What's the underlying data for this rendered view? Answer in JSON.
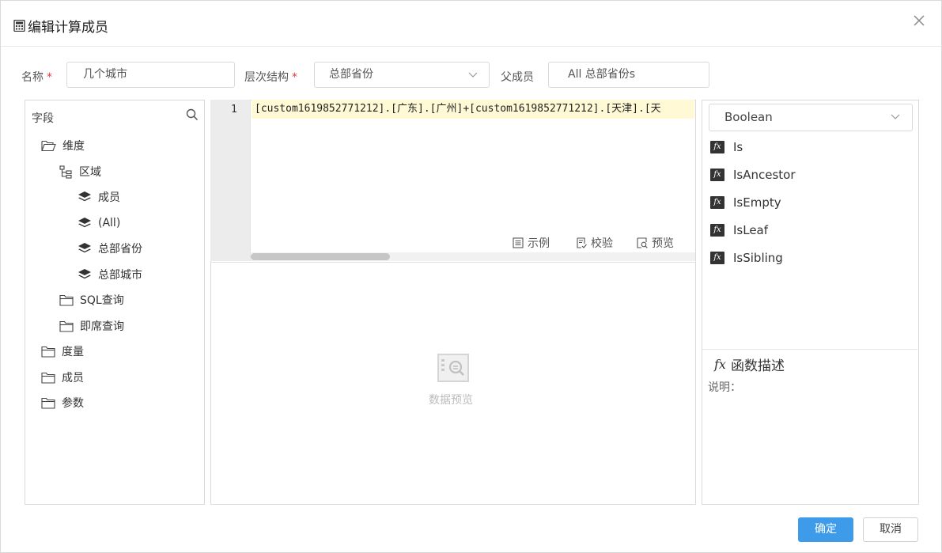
{
  "dialog": {
    "title": "编辑计算成员",
    "close_icon": "close-icon"
  },
  "form": {
    "name_label": "名称",
    "name_required": "*",
    "name_value": "几个城市",
    "hierarchy_label": "层次结构",
    "hierarchy_required": "*",
    "hierarchy_value": "总部省份",
    "parent_label": "父成员",
    "parent_value": "All 总部省份s"
  },
  "fields": {
    "header": "字段",
    "tree": [
      {
        "label": "维度",
        "icon": "folder-open-icon"
      },
      {
        "label": "区域",
        "icon": "hierarchy-icon"
      },
      {
        "label": "成员",
        "icon": "layers-icon"
      },
      {
        "label": "(All)",
        "icon": "layers-icon"
      },
      {
        "label": "总部省份",
        "icon": "layers-icon"
      },
      {
        "label": "总部城市",
        "icon": "layers-icon"
      },
      {
        "label": "SQL查询",
        "icon": "folder-icon"
      },
      {
        "label": "即席查询",
        "icon": "folder-icon"
      },
      {
        "label": "度量",
        "icon": "folder-icon"
      },
      {
        "label": "成员",
        "icon": "folder-icon"
      },
      {
        "label": "参数",
        "icon": "folder-icon"
      }
    ]
  },
  "editor": {
    "line_number": "1",
    "code": "[custom1619852771212].[广东].[广州]+[custom1619852771212].[天津].[天",
    "tools": {
      "example": "示例",
      "validate": "校验",
      "preview": "预览"
    }
  },
  "preview": {
    "empty_text": "数据预览"
  },
  "functions": {
    "category": "Boolean",
    "items": [
      "Is",
      "IsAncestor",
      "IsEmpty",
      "IsLeaf",
      "IsSibling"
    ],
    "desc_title": "函数描述",
    "desc_label": "说明："
  },
  "buttons": {
    "ok": "确定",
    "cancel": "取消"
  },
  "colors": {
    "primary": "#3d9be9",
    "required": "#e03e3e",
    "code_highlight": "#fff9d6"
  }
}
